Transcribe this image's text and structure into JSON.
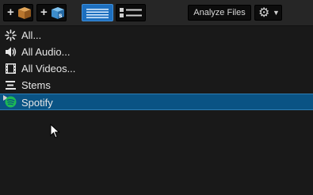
{
  "toolbar": {
    "add_library_icon": "cube-box-icon",
    "add_serato_icon": "serato-box-icon",
    "analyze_label": "Analyze Files",
    "settings_icon": "gear-icon"
  },
  "colors": {
    "background": "#191919",
    "toolbar": "#262626",
    "selected_row": "#0a5384",
    "accent_blue": "#1d6fbf",
    "spotify_green": "#1db954"
  },
  "library": {
    "items": [
      {
        "label": "All...",
        "icon": "sparkle-icon"
      },
      {
        "label": "All Audio...",
        "icon": "speaker-icon"
      },
      {
        "label": "All Videos...",
        "icon": "film-icon"
      },
      {
        "label": "Stems",
        "icon": "stems-icon"
      },
      {
        "label": "Spotify",
        "icon": "spotify-icon",
        "selected": true
      }
    ]
  }
}
